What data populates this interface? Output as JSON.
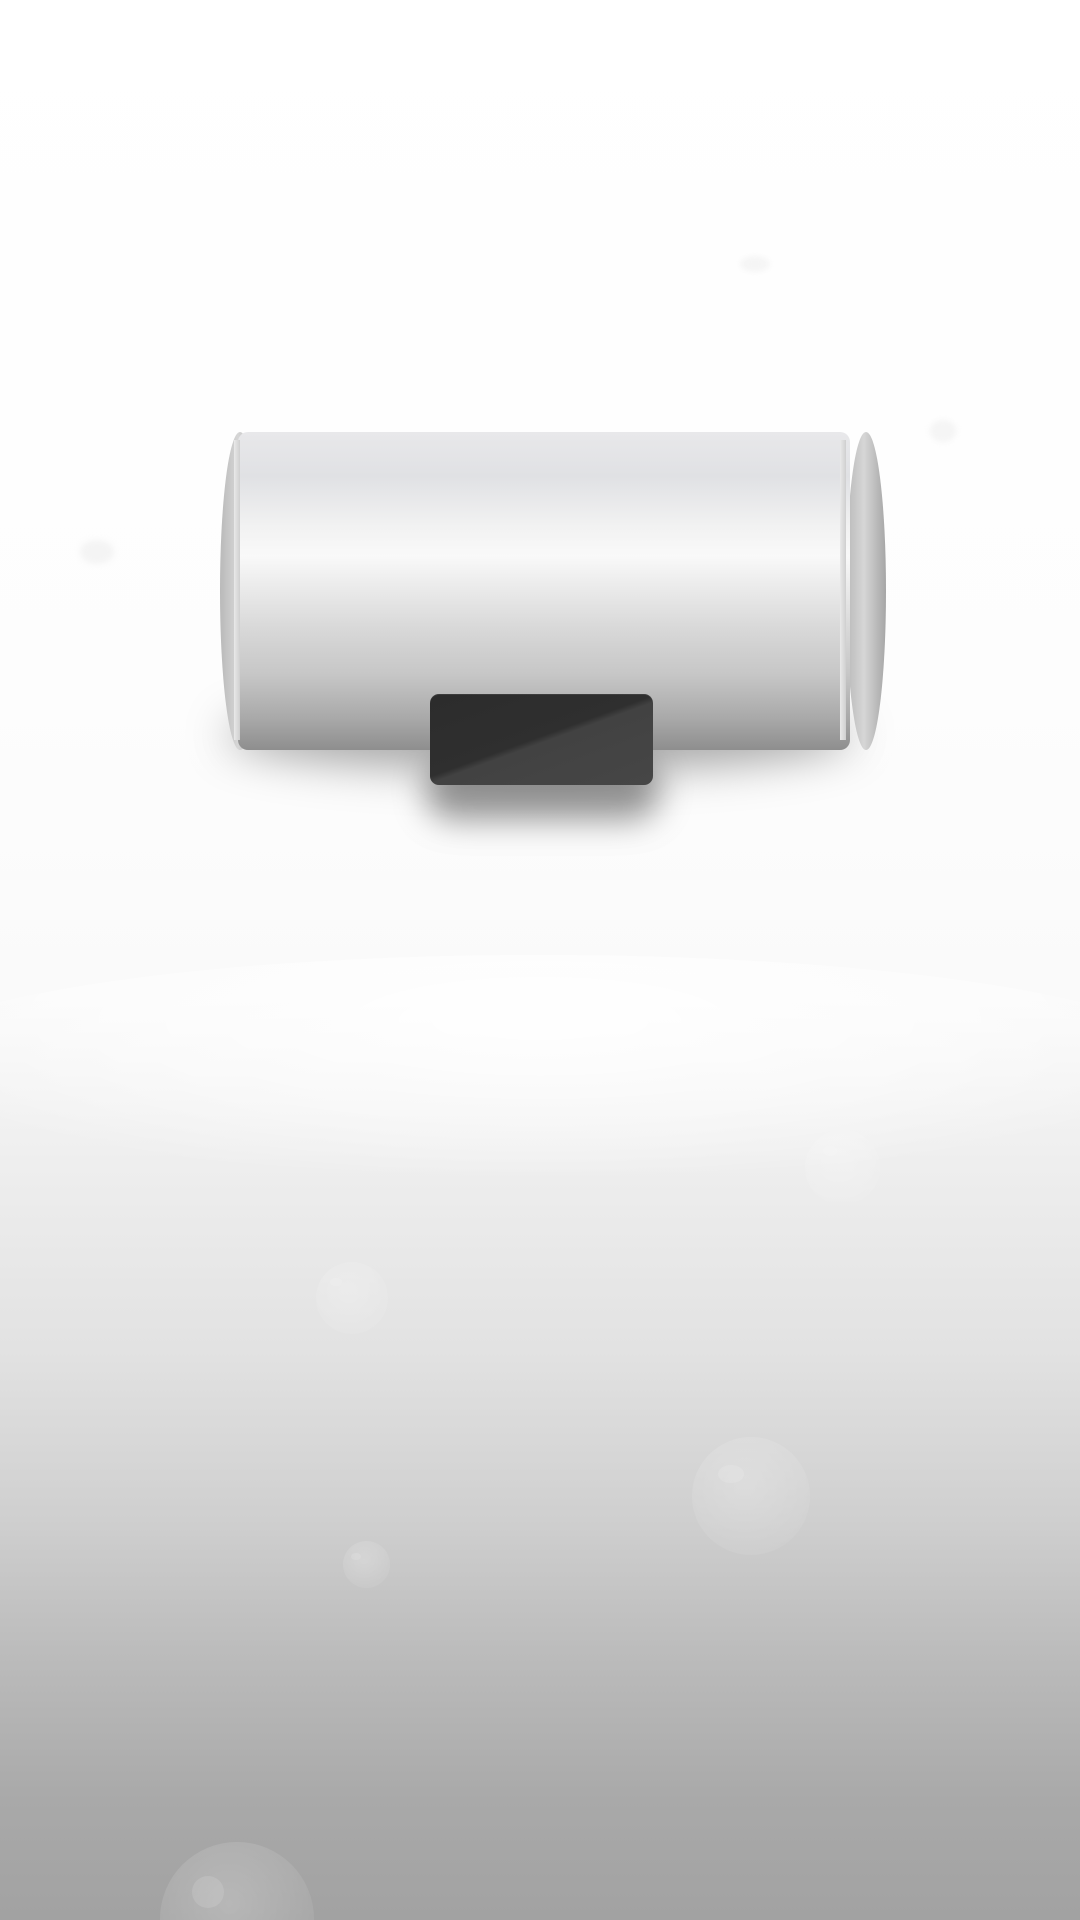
{
  "scene": {
    "object": "water-heater",
    "colors": {
      "background_top": "#ffffff",
      "background_bottom": "#a2a2a2",
      "heater_body": "#e6e6e8",
      "control_panel": "#333333"
    },
    "icons": [
      "water-heater-icon",
      "bubble-icon"
    ]
  }
}
